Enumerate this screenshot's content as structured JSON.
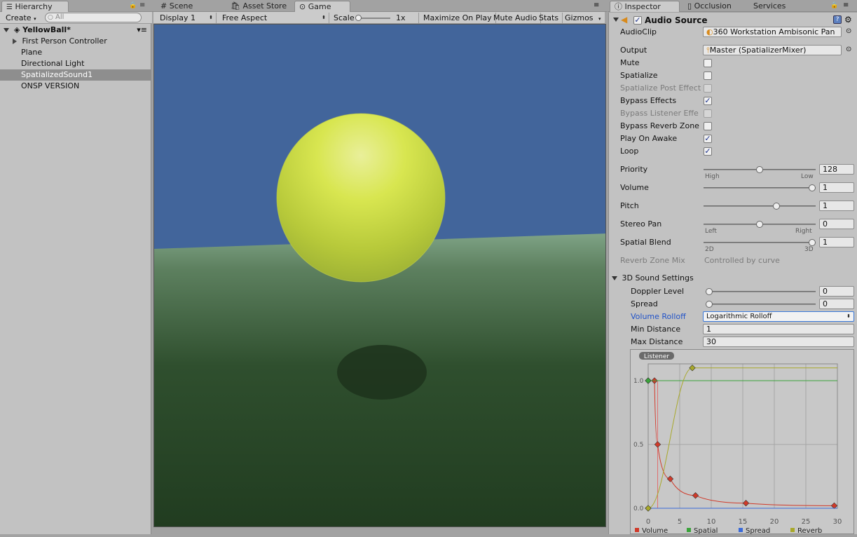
{
  "hierarchy": {
    "tab_label": "Hierarchy",
    "create_label": "Create",
    "search_placeholder": "All",
    "scene_name": "YellowBall*",
    "items": [
      {
        "label": "First Person Controller"
      },
      {
        "label": "Plane"
      },
      {
        "label": "Directional Light"
      },
      {
        "label": "SpatializedSound1"
      },
      {
        "label": "ONSP VERSION"
      }
    ]
  },
  "center_tabs": [
    {
      "label": "Scene"
    },
    {
      "label": "Asset Store"
    },
    {
      "label": "Game"
    }
  ],
  "game_toolbar": {
    "display": "Display 1",
    "aspect": "Free Aspect",
    "scale_label": "Scale",
    "scale_value": "1x",
    "maximize": "Maximize On Play",
    "mute": "Mute Audio",
    "stats": "Stats",
    "gizmos": "Gizmos"
  },
  "inspector_tabs": [
    {
      "label": "Inspector"
    },
    {
      "label": "Occlusion"
    },
    {
      "label": "Services"
    }
  ],
  "audio_source": {
    "title": "Audio Source",
    "audioclip_label": "AudioClip",
    "audioclip_value": "360 Workstation Ambisonic Pan",
    "output_label": "Output",
    "output_value": "Master (SpatializerMixer)",
    "checks": [
      {
        "label": "Mute",
        "checked": false,
        "disabled": false
      },
      {
        "label": "Spatialize",
        "checked": false,
        "disabled": false
      },
      {
        "label": "Spatialize Post Effect",
        "checked": false,
        "disabled": true
      },
      {
        "label": "Bypass Effects",
        "checked": true,
        "disabled": false
      },
      {
        "label": "Bypass Listener Effe",
        "checked": false,
        "disabled": true
      },
      {
        "label": "Bypass Reverb Zone",
        "checked": false,
        "disabled": false
      },
      {
        "label": "Play On Awake",
        "checked": true,
        "disabled": false
      },
      {
        "label": "Loop",
        "checked": true,
        "disabled": false
      }
    ],
    "priority": {
      "label": "Priority",
      "value": "128",
      "min_label": "High",
      "max_label": "Low",
      "level": 0.5
    },
    "volume": {
      "label": "Volume",
      "value": "1",
      "level": 1.0
    },
    "pitch": {
      "label": "Pitch",
      "value": "1",
      "level": 0.66
    },
    "stereo_pan": {
      "label": "Stereo Pan",
      "value": "0",
      "min_label": "Left",
      "max_label": "Right",
      "level": 0.5
    },
    "spatial_blend": {
      "label": "Spatial Blend",
      "value": "1",
      "min_label": "2D",
      "max_label": "3D",
      "level": 1.0
    },
    "reverb_zone_mix": {
      "label": "Reverb Zone Mix",
      "value": "Controlled by curve"
    }
  },
  "sound_3d": {
    "title": "3D Sound Settings",
    "doppler": {
      "label": "Doppler Level",
      "value": "0",
      "level": 0.0
    },
    "spread": {
      "label": "Spread",
      "value": "0",
      "level": 0.0
    },
    "rolloff_label": "Volume Rolloff",
    "rolloff_value": "Logarithmic Rolloff",
    "min_distance_label": "Min Distance",
    "min_distance_value": "1",
    "max_distance_label": "Max Distance",
    "max_distance_value": "30"
  },
  "chart_data": {
    "type": "line",
    "badge": "Listener",
    "xlim": [
      0,
      30
    ],
    "ylim": [
      0,
      1.0
    ],
    "x_ticks": [
      "0",
      "5",
      "10",
      "15",
      "20",
      "25",
      "30"
    ],
    "y_ticks": [
      "0.0",
      "0.5",
      "1.0"
    ],
    "listener_x": 1.5,
    "series": [
      {
        "name": "Volume",
        "color": "#d03a2a",
        "points": [
          [
            0,
            1.0
          ],
          [
            1,
            1.0
          ],
          [
            1.5,
            0.5
          ],
          [
            3.5,
            0.23
          ],
          [
            7.5,
            0.1
          ],
          [
            15.5,
            0.04
          ],
          [
            29.5,
            0.02
          ]
        ]
      },
      {
        "name": "Spatial",
        "color": "#3aa33a",
        "points": [
          [
            0,
            1.0
          ],
          [
            30,
            1.0
          ]
        ]
      },
      {
        "name": "Spread",
        "color": "#3a6ad8",
        "points": [
          [
            0,
            0.0
          ],
          [
            30,
            0.0
          ]
        ]
      },
      {
        "name": "Reverb",
        "color": "#a8a82a",
        "points": [
          [
            0,
            0.0
          ],
          [
            7,
            1.1
          ],
          [
            30,
            1.1
          ]
        ]
      }
    ],
    "legend": [
      "Volume",
      "Spatial",
      "Spread",
      "Reverb"
    ]
  }
}
